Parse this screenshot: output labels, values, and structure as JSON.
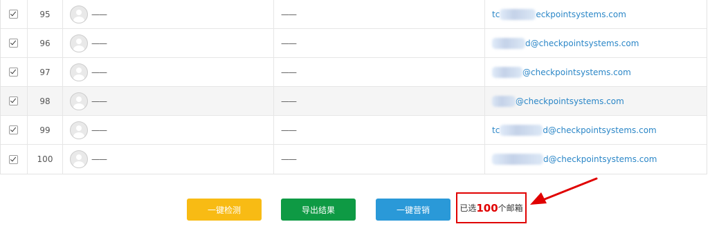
{
  "rows": [
    {
      "num": "95",
      "name": "——",
      "col3": "——",
      "email_prefix": "tc",
      "email_suffix": "eckpointsystems.com",
      "mask_width": 52
    },
    {
      "num": "96",
      "name": "——",
      "col3": "——",
      "email_prefix": "",
      "email_suffix": "d@checkpointsystems.com",
      "mask_width": 48
    },
    {
      "num": "97",
      "name": "——",
      "col3": "——",
      "email_prefix": "",
      "email_suffix": "@checkpointsystems.com",
      "mask_width": 44
    },
    {
      "num": "98",
      "name": "——",
      "col3": "——",
      "email_prefix": "",
      "email_suffix": "@checkpointsystems.com",
      "mask_width": 34
    },
    {
      "num": "99",
      "name": "——",
      "col3": "——",
      "email_prefix": "tc",
      "email_suffix": "d@checkpointsystems.com",
      "mask_width": 62
    },
    {
      "num": "100",
      "name": "——",
      "col3": "——",
      "email_prefix": "",
      "email_suffix": "d@checkpointsystems.com",
      "mask_width": 74
    }
  ],
  "highlighted_row_index": 3,
  "actions": {
    "detect_label": "一键检测",
    "export_label": "导出结果",
    "market_label": "一键营销"
  },
  "summary": {
    "prefix": "已选",
    "count": "100",
    "suffix": "个邮箱"
  },
  "colors": {
    "detect": "#f8bb14",
    "export": "#0e9a44",
    "market": "#2a99d8",
    "highlight_box": "#e00000",
    "email_link": "#2a86c7"
  }
}
